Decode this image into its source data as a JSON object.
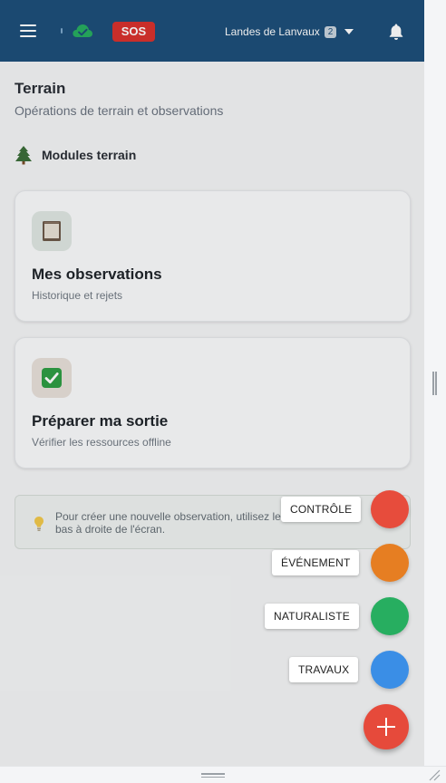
{
  "header": {
    "sos_label": "SOS",
    "site_name": "Landes de Lanvaux",
    "site_count": "2",
    "colors": {
      "bar": "#1e4f7a",
      "sos": "#d9322e",
      "cloud_ok": "#27ae60"
    },
    "icons": [
      "menu-icon",
      "cloud-check-icon",
      "caret-down-icon",
      "bell-icon"
    ]
  },
  "page": {
    "title": "Terrain",
    "subtitle": "Opérations de terrain et observations"
  },
  "section": {
    "label": "Modules terrain",
    "icon": "tree-icon"
  },
  "cards": [
    {
      "title": "Mes observations",
      "subtitle": "Historique et rejets",
      "icon": "notebook-icon"
    },
    {
      "title": "Préparer ma sortie",
      "subtitle": "Vérifier les ressources offline",
      "icon": "checkbox-icon"
    }
  ],
  "hint": {
    "text": "Pour créer une nouvelle observation, utilisez le bouton en bas à droite de l'écran.",
    "icon": "lightbulb-icon"
  },
  "fab": {
    "actions": [
      {
        "label": "CONTRÔLE",
        "color": "#e74c3c"
      },
      {
        "label": "ÉVÉNEMENT",
        "color": "#e67e22"
      },
      {
        "label": "NATURALISTE",
        "color": "#27ae60"
      },
      {
        "label": "TRAVAUX",
        "color": "#3a8ee6"
      }
    ],
    "main_color": "#e64a3b",
    "main_icon": "plus-icon"
  }
}
